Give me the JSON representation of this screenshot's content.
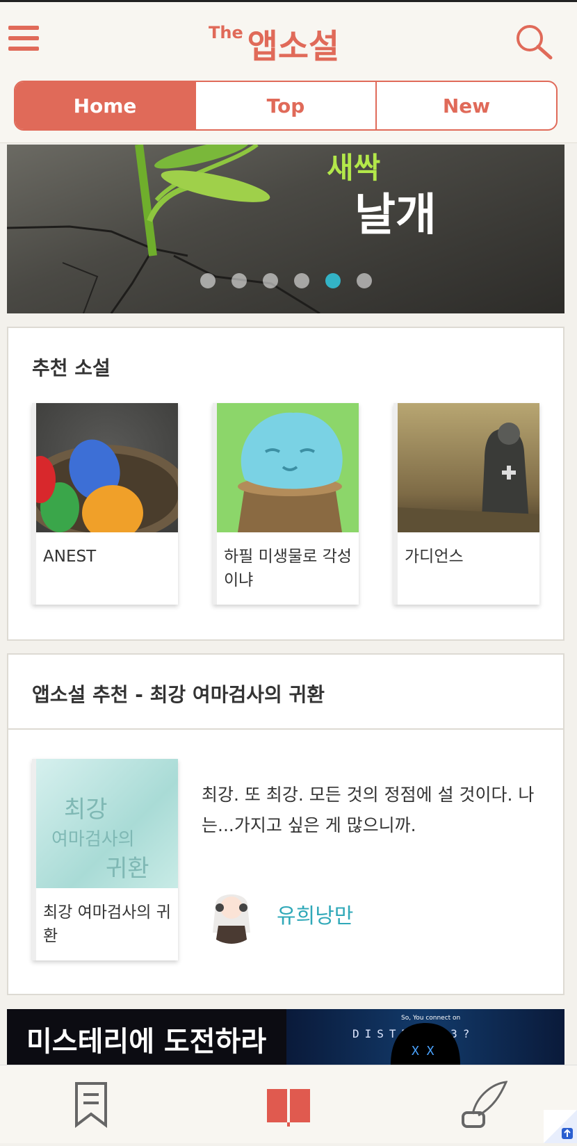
{
  "header": {
    "logo_prefix": "The",
    "logo_name": "앱소설",
    "accent_color": "#e06a59",
    "menu_icon": "hamburger-icon",
    "search_icon": "search-icon"
  },
  "tabs": [
    {
      "label": "Home",
      "active": true
    },
    {
      "label": "Top",
      "active": false
    },
    {
      "label": "New",
      "active": false
    }
  ],
  "banner": {
    "text_top": "새싹",
    "text_main": "날개",
    "slide_count": 6,
    "active_slide": 5
  },
  "recommended": {
    "title": "추천 소설",
    "books": [
      {
        "title": "ANEST"
      },
      {
        "title": "하필 미생물로 각성이냐"
      },
      {
        "title": "가디언스"
      }
    ]
  },
  "featured": {
    "title": "앱소설 추천 - 최강 여마검사의 귀환",
    "book_title": "최강 여마검사의 귀환",
    "cover_text_line1": "최강",
    "cover_text_line2": "여마검사의",
    "cover_text_line3": "귀환",
    "description": "최강. 또 최강. 모든 것의 정점에 설 것이다. 나는...가지고 싶은 게 많으니까.",
    "author": "유희낭만"
  },
  "ad": {
    "headline": "미스테리에 도전하라",
    "code_text": "DISTR  403?",
    "small_text": "So, You   connect on"
  },
  "bottom_nav": [
    "bookmark-icon",
    "book-icon",
    "quill-icon"
  ]
}
